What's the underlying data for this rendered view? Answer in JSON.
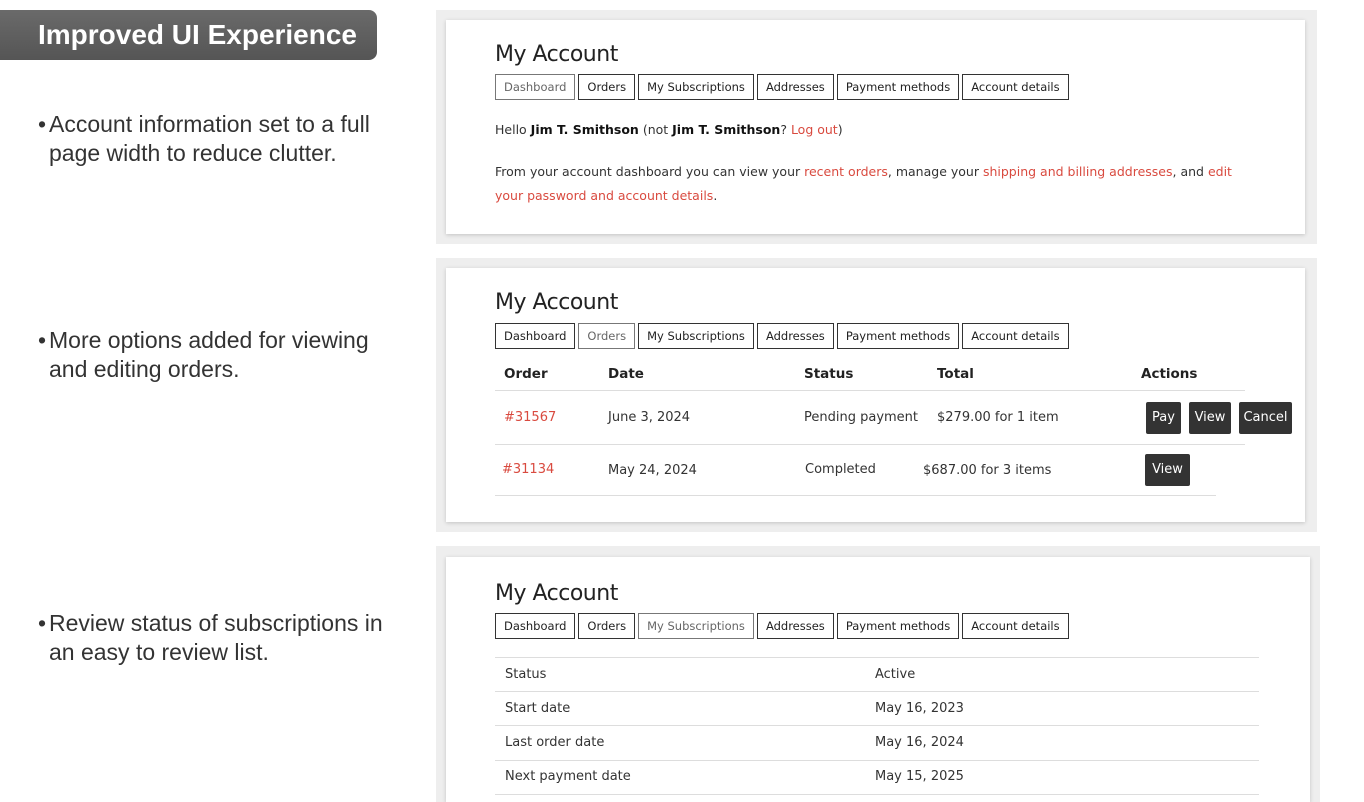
{
  "banner": {
    "title": "Improved UI Experience"
  },
  "bullets": [
    "Account information set to a full page width to reduce clutter.",
    "More options added for viewing and editing orders.",
    "Review status of subscriptions in an easy to review list."
  ],
  "bullet_glyph": "•",
  "account": {
    "title": "My Account",
    "tabs": [
      "Dashboard",
      "Orders",
      "My Subscriptions",
      "Addresses",
      "Payment methods",
      "Account details"
    ]
  },
  "dashboard": {
    "hello": "Hello",
    "user_name": "Jim T. Smithson",
    "not_prefix": "(not",
    "question": "?",
    "logout": "Log out",
    "close_paren": ")",
    "intro": "From your account dashboard you can view your",
    "recent_orders": "recent orders",
    "manage": ", manage your",
    "addresses_link": "shipping and billing addresses",
    "and": ", and",
    "edit_link": "edit your password and account details",
    "period": "."
  },
  "orders": {
    "headers": [
      "Order",
      "Date",
      "Status",
      "Total",
      "Actions"
    ],
    "rows": [
      {
        "order": "#31567",
        "date": "June 3, 2024",
        "status": "Pending payment",
        "total": "$279.00 for 1 item",
        "actions": [
          "Pay",
          "View",
          "Cancel"
        ]
      },
      {
        "order": "#31134",
        "date": "May 24, 2024",
        "status": "Completed",
        "total": "$687.00 for 3 items",
        "actions": [
          "View"
        ]
      }
    ]
  },
  "subscription": {
    "rows": [
      {
        "label": "Status",
        "value": "Active"
      },
      {
        "label": "Start date",
        "value": "May 16, 2023"
      },
      {
        "label": "Last order date",
        "value": "May 16, 2024"
      },
      {
        "label": "Next payment date",
        "value": "May 15, 2025"
      }
    ]
  },
  "colors": {
    "link": "#d94a3f",
    "button": "#333333",
    "banner": "#5e5e5e"
  }
}
